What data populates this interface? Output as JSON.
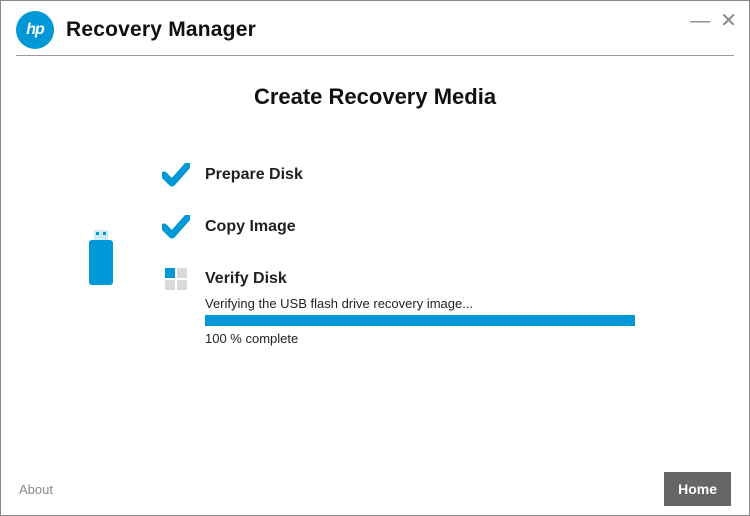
{
  "header": {
    "logo_text": "hp",
    "app_title": "Recovery Manager"
  },
  "page": {
    "title": "Create Recovery Media"
  },
  "steps": {
    "prepare": {
      "label": "Prepare Disk",
      "done": true
    },
    "copy": {
      "label": "Copy Image",
      "done": true
    },
    "verify": {
      "label": "Verify Disk",
      "status": "Verifying the USB flash drive recovery image...",
      "percent_text": "100 % complete",
      "percent": 100
    }
  },
  "footer": {
    "about": "About",
    "home": "Home"
  },
  "colors": {
    "accent": "#0098d6",
    "button": "#666666"
  }
}
